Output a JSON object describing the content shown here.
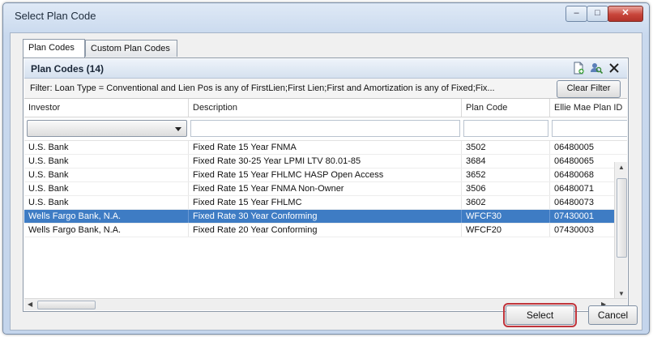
{
  "window": {
    "title": "Select Plan Code",
    "min_label": "–",
    "max_label": "□",
    "close_label": "✕"
  },
  "tabs": [
    {
      "label": "Plan Codes",
      "active": true
    },
    {
      "label": "Custom Plan Codes",
      "active": false
    }
  ],
  "panel": {
    "title": "Plan Codes (14)",
    "icons": [
      "new-document-icon",
      "search-user-icon",
      "close-icon"
    ],
    "filter_text": "Filter: Loan Type = Conventional  and  Lien Pos is any of FirstLien;First Lien;First  and  Amortization is any of Fixed;Fix...",
    "clear_filter_label": "Clear Filter"
  },
  "grid": {
    "columns": [
      "Investor",
      "Description",
      "Plan Code",
      "Ellie Mae Plan ID"
    ],
    "rows": [
      {
        "investor": "U.S. Bank",
        "description": "Fixed Rate 15 Year  FNMA",
        "plan_code": "3502",
        "plan_id": "06480005",
        "selected": false
      },
      {
        "investor": "U.S. Bank",
        "description": "Fixed Rate 30-25 Year LPMI LTV 80.01-85",
        "plan_code": "3684",
        "plan_id": "06480065",
        "selected": false
      },
      {
        "investor": "U.S. Bank",
        "description": "Fixed Rate 15 Year FHLMC HASP Open Access",
        "plan_code": "3652",
        "plan_id": "06480068",
        "selected": false
      },
      {
        "investor": "U.S. Bank",
        "description": "Fixed Rate 15 Year  FNMA Non-Owner",
        "plan_code": "3506",
        "plan_id": "06480071",
        "selected": false
      },
      {
        "investor": "U.S. Bank",
        "description": "Fixed Rate 15 Year FHLMC",
        "plan_code": "3602",
        "plan_id": "06480073",
        "selected": false
      },
      {
        "investor": "Wells Fargo Bank, N.A.",
        "description": "Fixed Rate 30 Year Conforming",
        "plan_code": "WFCF30",
        "plan_id": "07430001",
        "selected": true
      },
      {
        "investor": "Wells Fargo Bank, N.A.",
        "description": "Fixed Rate 20 Year Conforming",
        "plan_code": "WFCF20",
        "plan_id": "07430003",
        "selected": false
      }
    ]
  },
  "buttons": {
    "select_label": "Select",
    "cancel_label": "Cancel"
  },
  "colors": {
    "selection": "#3e7cc4",
    "select_highlight": "#c0343b"
  }
}
